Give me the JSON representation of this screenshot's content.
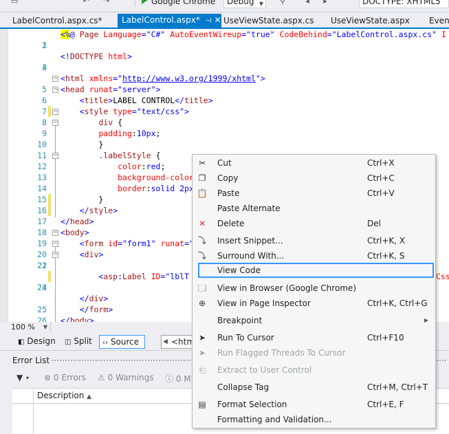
{
  "toolbar": {
    "run_target": "Google Chrome",
    "configuration": "Debug",
    "doctype": "DOCTYPE: XHTML5"
  },
  "tabs": [
    {
      "label": "LabelControl.aspx.cs*",
      "active": false
    },
    {
      "label": "LabelControl.aspx*",
      "active": true
    },
    {
      "label": "UseViewState.aspx.cs",
      "active": false
    },
    {
      "label": "UseViewState.aspx",
      "active": false
    },
    {
      "label": "Event",
      "active": false
    }
  ],
  "editor": {
    "lines": [
      {
        "n": "1",
        "code": "<%@ Page Language=\"C#\" AutoEventWireup=\"true\" CodeBehind=\"LabelControl.aspx.cs\" I"
      },
      {
        "n": "2",
        "code": ""
      },
      {
        "n": "3",
        "code": "<!DOCTYPE html>"
      },
      {
        "n": "4",
        "code": ""
      },
      {
        "n": "5",
        "code": "<html xmlns=\"http://www.w3.org/1999/xhtml\">"
      },
      {
        "n": "6",
        "code": "<head runat=\"server\">"
      },
      {
        "n": "7",
        "code": "    <title>LABEL CONTROL</title>"
      },
      {
        "n": "8",
        "code": "    <style type=\"text/css\">"
      },
      {
        "n": "9",
        "code": "        div {"
      },
      {
        "n": "10",
        "code": "        padding:10px;"
      },
      {
        "n": "11",
        "code": "        }"
      },
      {
        "n": "12",
        "code": "        .labelStyle {"
      },
      {
        "n": "13",
        "code": "            color:red;"
      },
      {
        "n": "14",
        "code": "            background-color"
      },
      {
        "n": "15",
        "code": "            border:solid 2px"
      },
      {
        "n": "16",
        "code": "        }"
      },
      {
        "n": "17",
        "code": "    </style>"
      },
      {
        "n": "18",
        "code": "</head>"
      },
      {
        "n": "19",
        "code": "<body>"
      },
      {
        "n": "20",
        "code": "    <form id=\"form1\" runat=\""
      },
      {
        "n": "21",
        "code": "    <div>"
      },
      {
        "n": "22",
        "code": ""
      },
      {
        "n": "23",
        "code": "        <asp:Label ID=\"lblT"
      },
      {
        "n": "24",
        "code": ""
      },
      {
        "n": "25",
        "code": "    </div>"
      },
      {
        "n": "26",
        "code": "    </form>"
      },
      {
        "n": "27",
        "code": "</body>"
      }
    ],
    "line23_tail": "Css"
  },
  "zoom": "100 %",
  "views": {
    "design": "Design",
    "split": "Split",
    "source": "Source",
    "breadcrumb": "<html>"
  },
  "error_list": {
    "title": "Error List",
    "errors": "0 Errors",
    "warnings": "0 Warnings",
    "messages": "0 M",
    "col_description": "Description"
  },
  "context_menu": [
    {
      "label": "Cut",
      "shortcut": "Ctrl+X",
      "icon": "scissors-icon"
    },
    {
      "label": "Copy",
      "shortcut": "Ctrl+C",
      "icon": "copy-icon"
    },
    {
      "label": "Paste",
      "shortcut": "Ctrl+V",
      "icon": "paste-icon"
    },
    {
      "label": "Paste Alternate",
      "shortcut": "",
      "icon": ""
    },
    {
      "label": "Delete",
      "shortcut": "Del",
      "icon": "delete-x-icon"
    },
    {
      "label": "Insert Snippet...",
      "shortcut": "Ctrl+K, X",
      "icon": "snippet-icon"
    },
    {
      "label": "Surround With...",
      "shortcut": "Ctrl+K, S",
      "icon": "surround-icon"
    },
    {
      "label": "View Code",
      "shortcut": "",
      "icon": ""
    },
    {
      "label": "View in Browser (Google Chrome)",
      "shortcut": "",
      "icon": "browser-icon"
    },
    {
      "label": "View in Page Inspector",
      "shortcut": "Ctrl+K, Ctrl+G",
      "icon": "inspector-icon"
    },
    {
      "label": "Breakpoint",
      "shortcut": "",
      "icon": ""
    },
    {
      "label": "Run To Cursor",
      "shortcut": "Ctrl+F10",
      "icon": "cursor-arrow-icon"
    },
    {
      "label": "Run Flagged Threads To Cursor",
      "shortcut": "",
      "icon": "flagged-cursor-icon"
    },
    {
      "label": "Extract to User Control",
      "shortcut": "",
      "icon": "extract-icon"
    },
    {
      "label": "Collapse Tag",
      "shortcut": "Ctrl+M, Ctrl+T",
      "icon": ""
    },
    {
      "label": "Format Selection",
      "shortcut": "Ctrl+E, F",
      "icon": "format-icon"
    },
    {
      "label": "Formatting and Validation...",
      "shortcut": "",
      "icon": ""
    }
  ],
  "colors": {
    "accent": "#007acc",
    "focus_border": "#3399ff",
    "keyword": "#0000ff",
    "attribute": "#ff0000",
    "tag": "#a31515",
    "line_number": "#2b91af"
  }
}
